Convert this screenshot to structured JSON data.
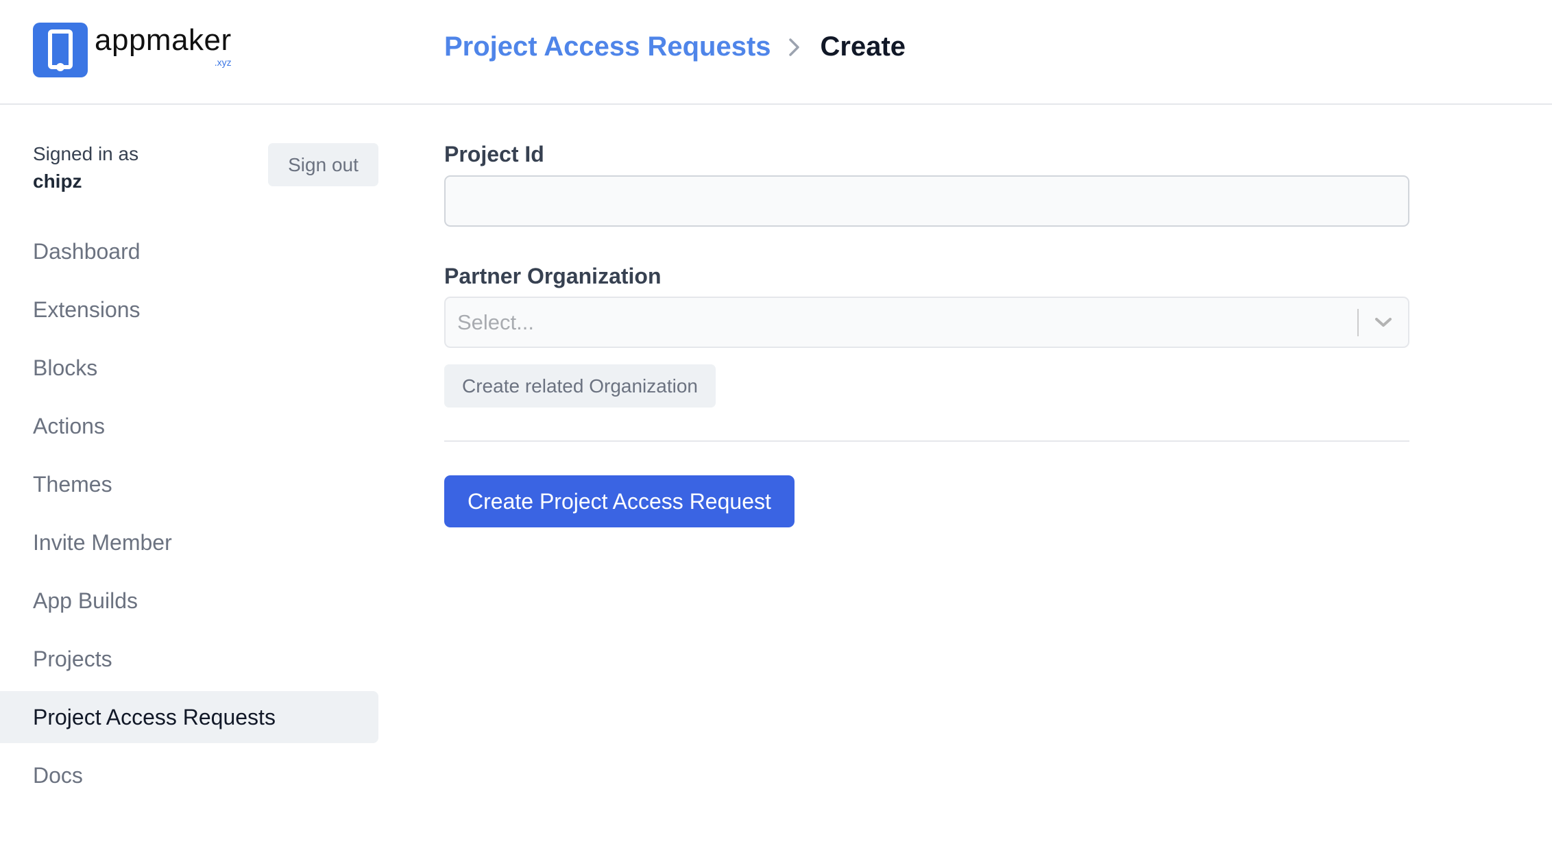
{
  "brand": {
    "name": "appmaker",
    "tld": ".xyz",
    "icon": "phone-icon",
    "color": "#3b76e4"
  },
  "breadcrumb": {
    "parent": "Project Access Requests",
    "separator_icon": "chevron-right-icon",
    "current": "Create",
    "link_color": "#4f85e9"
  },
  "session": {
    "signed_in_label": "Signed in as",
    "username": "chipz",
    "sign_out_label": "Sign out"
  },
  "sidebar": {
    "items": [
      {
        "label": "Dashboard",
        "active": false
      },
      {
        "label": "Extensions",
        "active": false
      },
      {
        "label": "Blocks",
        "active": false
      },
      {
        "label": "Actions",
        "active": false
      },
      {
        "label": "Themes",
        "active": false
      },
      {
        "label": "Invite Member",
        "active": false
      },
      {
        "label": "App Builds",
        "active": false
      },
      {
        "label": "Projects",
        "active": false
      },
      {
        "label": "Project Access Requests",
        "active": true
      },
      {
        "label": "Docs",
        "active": false
      }
    ]
  },
  "form": {
    "project_id": {
      "label": "Project Id",
      "value": "",
      "placeholder": ""
    },
    "partner_organization": {
      "label": "Partner Organization",
      "placeholder": "Select...",
      "value": "",
      "dropdown_icon": "chevron-down-icon"
    },
    "create_related_label": "Create related Organization",
    "submit_label": "Create Project Access Request",
    "submit_color": "#3a64e3"
  }
}
